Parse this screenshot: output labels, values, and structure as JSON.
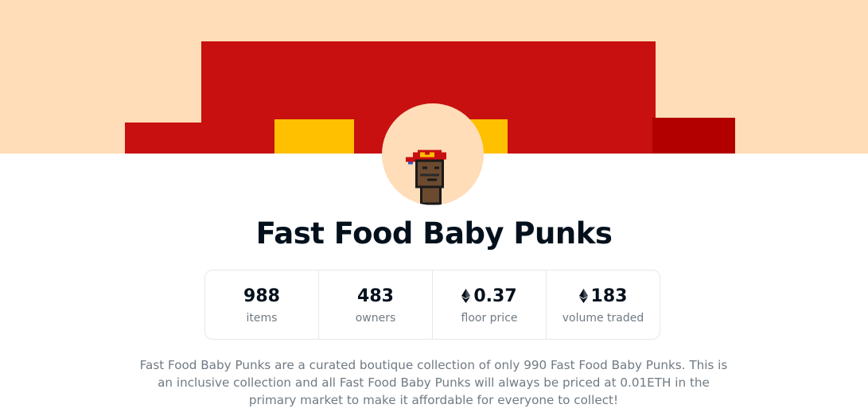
{
  "collection": {
    "title": "Fast Food Baby Punks",
    "description": "Fast Food Baby Punks are a curated boutique collection of only 990 Fast Food Baby Punks. This is an inclusive collection and all Fast Food Baby Punks will always be priced at 0.01ETH in the primary market to make it affordable for everyone to collect!"
  },
  "stats": [
    {
      "value": "988",
      "label": "items",
      "icon": null
    },
    {
      "value": "483",
      "label": "owners",
      "icon": null
    },
    {
      "value": "0.37",
      "label": "floor price",
      "icon": "ethereum-icon"
    },
    {
      "value": "183",
      "label": "volume traded",
      "icon": "ethereum-icon"
    }
  ],
  "colors": {
    "banner_bg": "#ffddb8",
    "hat_red": "#c81010",
    "arch_yellow": "#ffc000",
    "title_text": "#04111d",
    "muted_text": "#707a83",
    "border": "#e5e8eb"
  }
}
